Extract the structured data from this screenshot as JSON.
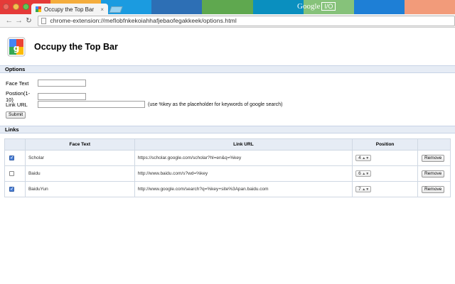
{
  "browser": {
    "tab_title": "Occupy the Top Bar",
    "tab_close": "×",
    "url": "chrome-extension://meflobfnkekoiahhafjebaofegakkeek/options.html",
    "io_word": "Google",
    "io_badge": "I/O"
  },
  "colors": {
    "titlebar_segments": [
      "#e53a38",
      "#f4ad3d",
      "#1b9be0",
      "#2d6fb5",
      "#5fa84f",
      "#0a8fbf",
      "#86c27a",
      "#1e7fd6",
      "#f29b7a"
    ]
  },
  "page": {
    "title": "Occupy the Top Bar"
  },
  "options": {
    "heading": "Options",
    "face_text_label": "Face Text",
    "position_label": "Postion(1-10)",
    "link_url_label": "Link URL",
    "link_hint": "(use %key as the placeholder for keywords of google search)",
    "face_text_value": "",
    "position_value": "",
    "link_url_value": "",
    "submit_label": "Submit"
  },
  "links": {
    "heading": "Links",
    "columns": [
      "",
      "Face Text",
      "Link URL",
      "Position",
      ""
    ],
    "remove_label": "Remove",
    "rows": [
      {
        "checked": true,
        "face": "Scholar",
        "url": "https://scholar.google.com/scholar?hl=en&q=%key",
        "position": "4"
      },
      {
        "checked": false,
        "face": "Baidu",
        "url": "http://www.baidu.com/s?wd=%key",
        "position": "6"
      },
      {
        "checked": true,
        "face": "BaiduYun",
        "url": "http://www.google.com/search?q=%key+site%3Apan.baidu.com",
        "position": "7"
      }
    ]
  }
}
